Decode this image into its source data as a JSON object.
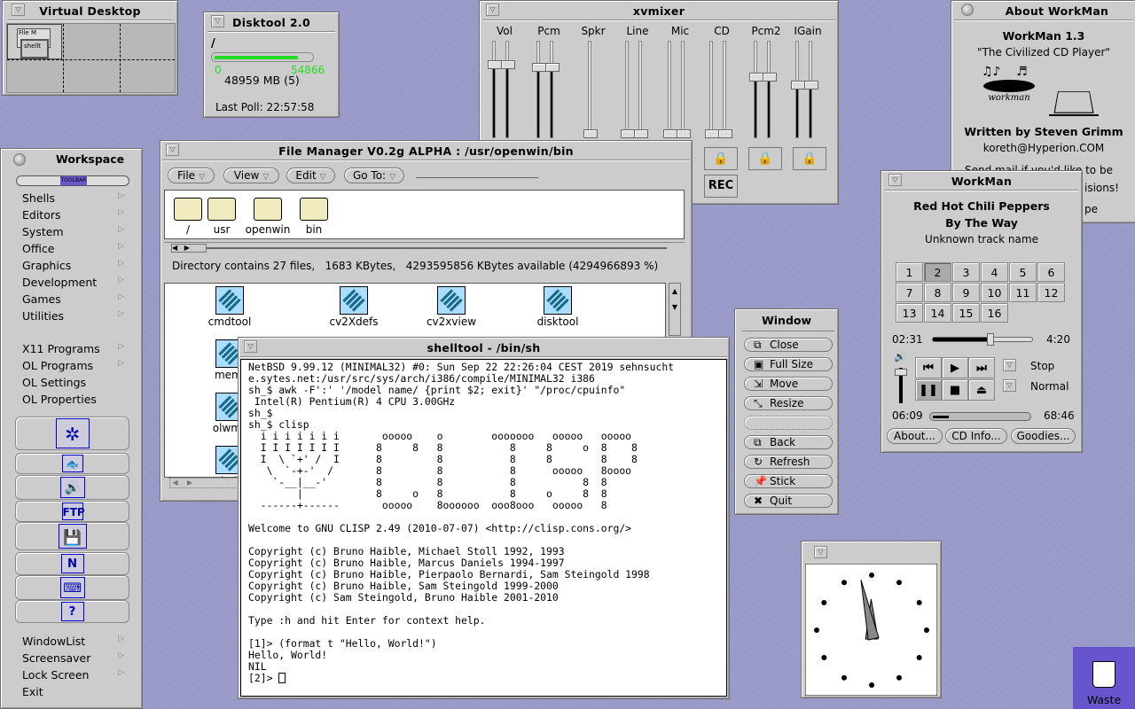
{
  "colors": {
    "desktop": "#9c9ccc",
    "window": "#cccccc",
    "disk_bar": "#22dd22",
    "waste_bg": "#6655cc",
    "icon_bg": "#aaddff"
  },
  "virtual_desktop": {
    "title": "Virtual Desktop",
    "mini_windows": [
      "W",
      "D",
      "xvmi",
      "Ab",
      "Wo",
      "File M",
      "Wo",
      "shellt"
    ]
  },
  "disktool": {
    "title": "Disktool 2.0",
    "mount": "/",
    "min": "0",
    "max": "54866",
    "usage": "48959 MB (5)",
    "used_fraction": 0.89,
    "last_poll": "Last Poll: 22:57:58"
  },
  "xvmixer": {
    "title": "xvmixer",
    "channels": [
      {
        "label": "Vol",
        "levels": [
          75,
          75
        ]
      },
      {
        "label": "Pcm",
        "levels": [
          72,
          72
        ]
      },
      {
        "label": "Spkr",
        "levels": [
          0
        ]
      },
      {
        "label": "Line",
        "levels": [
          0,
          0
        ]
      },
      {
        "label": "Mic",
        "levels": [
          0,
          0
        ]
      },
      {
        "label": "CD",
        "levels": [
          0,
          0
        ]
      },
      {
        "label": "Pcm2",
        "levels": [
          62,
          62
        ]
      },
      {
        "label": "IGain",
        "levels": [
          53,
          53
        ]
      }
    ],
    "lock_icon": "lock-icon",
    "rec_label": "REC"
  },
  "about": {
    "title": "About WorkMan",
    "name": "WorkMan 1.3",
    "tagline": "\"The Civilized CD Player\"",
    "logo_text": "workman",
    "author": "Written by Steven Grimm",
    "email": "koreth@Hyperion.COM",
    "line1": "Send mail if you'd like to be",
    "line2": "isions!",
    "line3": "pe"
  },
  "workspace": {
    "title": "Workspace",
    "toolbar_label": "TOOLBAR",
    "items": [
      {
        "label": "Shells",
        "sub": true
      },
      {
        "label": "Editors",
        "sub": true
      },
      {
        "label": "System",
        "sub": true
      },
      {
        "label": "Office",
        "sub": true
      },
      {
        "label": "Graphics",
        "sub": true
      },
      {
        "label": "Development",
        "sub": true
      },
      {
        "label": "Games",
        "sub": true
      },
      {
        "label": "Utilities",
        "sub": true
      }
    ],
    "items2": [
      {
        "label": "X11 Programs",
        "sub": true
      },
      {
        "label": "OL Programs",
        "sub": true
      },
      {
        "label": "OL Settings",
        "sub": false
      },
      {
        "label": "OL Properties",
        "sub": false
      }
    ],
    "tool_buttons": [
      "sun-logo-icon",
      "fish-icon",
      "speaker-icon",
      "ftp-icon",
      "floppy-file-icon",
      "netscape-icon",
      "keyboard-icon",
      "help-icon"
    ],
    "items3": [
      {
        "label": "WindowList",
        "sub": true
      },
      {
        "label": "Screensaver",
        "sub": true
      },
      {
        "label": "Lock Screen",
        "sub": true
      },
      {
        "label": "Exit",
        "sub": false
      }
    ]
  },
  "file_manager": {
    "title": "File Manager V0.2g ALPHA : /usr/openwin/bin",
    "menus": [
      "File",
      "View",
      "Edit",
      "Go To:"
    ],
    "path": [
      "/",
      "usr",
      "openwin",
      "bin"
    ],
    "status": "Directory contains 27 files,   1683 KBytes,   4293595856 KBytes available (4294966893 %)",
    "files": [
      "cmdtool",
      "cv2Xdefs",
      "cv2xview",
      "disktool",
      "memi",
      "olwms",
      "shellt"
    ]
  },
  "window_menu": {
    "title": "Window",
    "items": [
      "Close",
      "Full Size",
      "Move",
      "Resize",
      "",
      "Back",
      "Refresh",
      "Stick",
      "Quit"
    ]
  },
  "workman": {
    "title": "WorkMan",
    "artist": "Red Hot Chili Peppers",
    "album": "By The Way",
    "track_name": "Unknown track name",
    "tracks": [
      "1",
      "2",
      "3",
      "4",
      "5",
      "6",
      "7",
      "8",
      "9",
      "10",
      "11",
      "12",
      "13",
      "14",
      "15",
      "16"
    ],
    "selected_track": "2",
    "elapsed": "02:31",
    "track_length": "4:20",
    "track_progress": 0.58,
    "total_elapsed": "06:09",
    "total_length": "68:46",
    "disc_progress": 0.09,
    "volume": 0.85,
    "mode1": "Stop",
    "mode2": "Normal",
    "about_btn": "About...",
    "cdinfo_btn": "CD Info...",
    "goodies_btn": "Goodies..."
  },
  "shelltool": {
    "title": "shelltool - /bin/sh",
    "lines": [
      "NetBSD 9.99.12 (MINIMAL32) #0: Sun Sep 22 22:26:04 CEST 2019 sehnsucht",
      "e.sytes.net:/usr/src/sys/arch/i386/compile/MINIMAL32 i386",
      "sh_$ awk -F':' '/model name/ {print $2; exit}' \"/proc/cpuinfo\"",
      " Intel(R) Pentium(R) 4 CPU 3.00GHz",
      "sh_$",
      "sh_$ clisp",
      "  i i i i i i i       ooooo    o        ooooooo   ooooo   ooooo",
      "  I I I I I I I      8     8   8           8     8     o  8    8",
      "  I  \\ `+' /  I      8         8           8     8        8    8",
      "   \\  `-+-'  /       8         8           8      ooooo   8oooo",
      "    `-__|__-'        8         8           8           8  8",
      "        |            8     o   8           8     o     8  8",
      "  ------+------       ooooo    8oooooo  ooo8ooo   ooooo   8",
      "",
      "Welcome to GNU CLISP 2.49 (2010-07-07) <http://clisp.cons.org/>",
      "",
      "Copyright (c) Bruno Haible, Michael Stoll 1992, 1993",
      "Copyright (c) Bruno Haible, Marcus Daniels 1994-1997",
      "Copyright (c) Bruno Haible, Pierpaolo Bernardi, Sam Steingold 1998",
      "Copyright (c) Bruno Haible, Sam Steingold 1999-2000",
      "Copyright (c) Sam Steingold, Bruno Haible 2001-2010",
      "",
      "Type :h and hit Enter for context help.",
      "",
      "[1]> (format t \"Hello, World!\")",
      "Hello, World!",
      "NIL",
      "[2]> "
    ]
  },
  "clock": {
    "time": "11:58"
  },
  "waste": {
    "label": "Waste"
  }
}
